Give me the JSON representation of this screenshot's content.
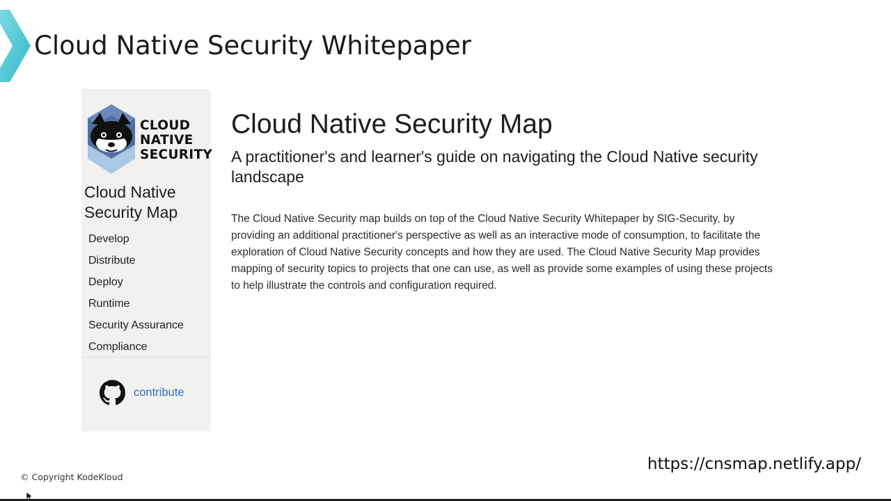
{
  "slide": {
    "title": "Cloud Native Security Whitepaper",
    "copyright": "© Copyright KodeKloud",
    "url": "https://cnsmap.netlify.app/"
  },
  "sidebar": {
    "logo": {
      "icon": "raccoon-shield-logo",
      "text_lines": [
        "CLOUD",
        "NATIVE",
        "SECURITY"
      ]
    },
    "title": "Cloud Native Security Map",
    "items": [
      {
        "label": "Develop"
      },
      {
        "label": "Distribute"
      },
      {
        "label": "Deploy"
      },
      {
        "label": "Runtime"
      },
      {
        "label": "Security Assurance"
      },
      {
        "label": "Compliance"
      }
    ],
    "contribute": {
      "icon": "github-icon",
      "label": "contribute"
    }
  },
  "main": {
    "title": "Cloud Native Security Map",
    "subtitle": "A practitioner's and learner's guide on navigating the Cloud Native security landscape",
    "description": "The Cloud Native Security map builds on top of the Cloud Native Security Whitepaper by SIG-Security, by providing an additional practitioner's perspective as well as an interactive mode of consumption, to facilitate the exploration of Cloud Native Security concepts and how they are used. The Cloud Native Security Map provides mapping of security topics to projects that one can use, as well as provide some examples of using these projects to help illustrate the controls and configuration required."
  },
  "colors": {
    "accent_cyan": "#3ec9d8",
    "sidebar_bg": "#f2f1f0",
    "link_blue": "#2e6fc0",
    "logo_blue": "#4f6fa6",
    "logo_light_blue": "#a9c8e3"
  }
}
